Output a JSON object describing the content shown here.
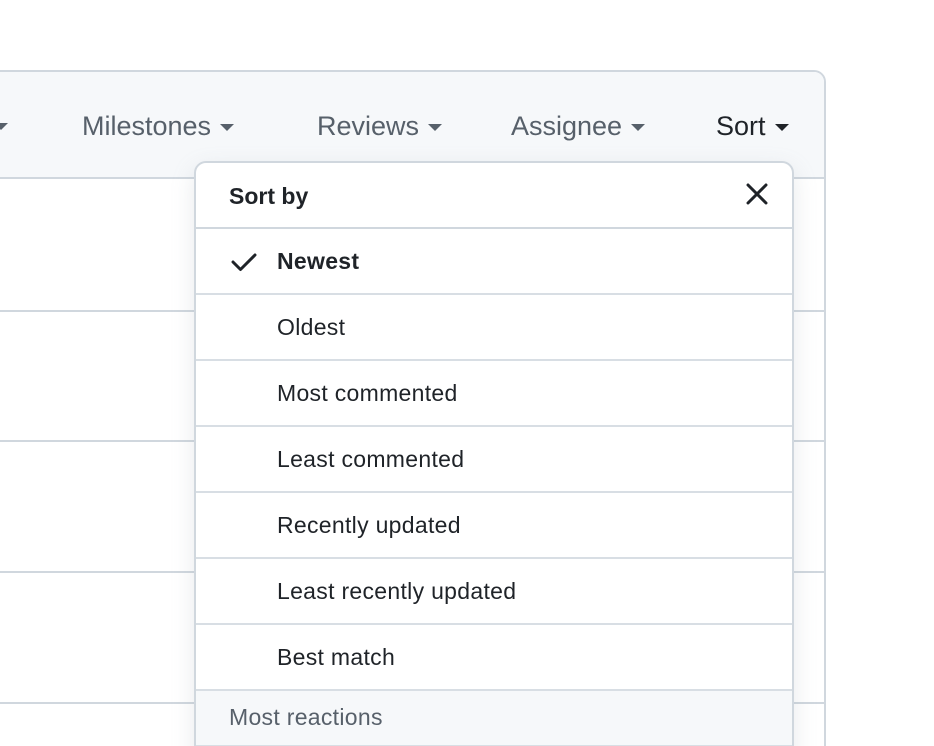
{
  "filter_bar": {
    "items": [
      {
        "label": "Milestones"
      },
      {
        "label": "Reviews"
      },
      {
        "label": "Assignee"
      },
      {
        "label": "Sort"
      }
    ]
  },
  "sort_menu": {
    "title": "Sort by",
    "close_icon": "close-icon",
    "selected_icon": "check-icon",
    "selected": "Newest",
    "items": [
      {
        "label": "Newest"
      },
      {
        "label": "Oldest"
      },
      {
        "label": "Most commented"
      },
      {
        "label": "Least commented"
      },
      {
        "label": "Recently updated"
      },
      {
        "label": "Least recently updated"
      },
      {
        "label": "Best match"
      }
    ],
    "section_label": "Most reactions"
  }
}
